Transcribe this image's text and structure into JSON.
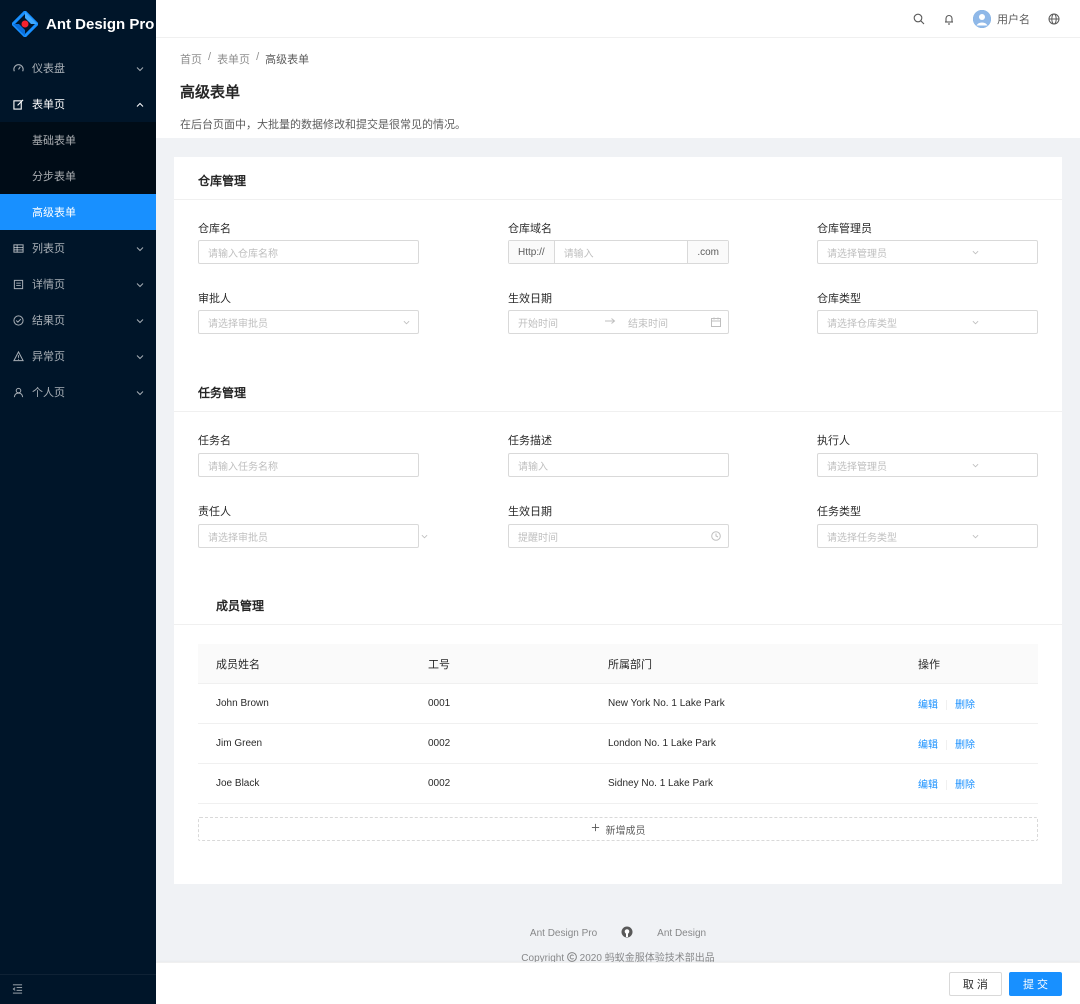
{
  "brand": {
    "title": "Ant Design Pro",
    "accent": "#1890ff"
  },
  "sidebar": {
    "items": [
      {
        "label": "仪表盘",
        "icon": "dashboard-icon"
      },
      {
        "label": "表单页",
        "icon": "form-icon",
        "open": true
      },
      {
        "label": "列表页",
        "icon": "table-icon"
      },
      {
        "label": "详情页",
        "icon": "profile-icon"
      },
      {
        "label": "结果页",
        "icon": "check-circle-icon"
      },
      {
        "label": "异常页",
        "icon": "warning-icon"
      },
      {
        "label": "个人页",
        "icon": "user-icon"
      }
    ],
    "sub_items": [
      {
        "label": "基础表单"
      },
      {
        "label": "分步表单"
      },
      {
        "label": "高级表单",
        "active": true
      }
    ]
  },
  "header": {
    "username": "用户名"
  },
  "page": {
    "breadcrumb": [
      "首页",
      "/",
      "表单页",
      "/",
      "高级表单"
    ],
    "title": "高级表单",
    "description": "在后台页面中，大批量的数据修改和提交是很常见的情况。"
  },
  "warehouse": {
    "title": "仓库管理",
    "name_label": "仓库名",
    "name_placeholder": "请输入仓库名称",
    "domain_label": "仓库域名",
    "domain_prefix": "Http://",
    "domain_placeholder": "请输入",
    "domain_suffix": ".com",
    "admin_label": "仓库管理员",
    "admin_placeholder": "请选择管理员",
    "approver_label": "审批人",
    "approver_placeholder": "请选择审批员",
    "date_label": "生效日期",
    "date_start": "开始时间",
    "date_end": "结束时间",
    "type_label": "仓库类型",
    "type_placeholder": "请选择仓库类型"
  },
  "task": {
    "title": "任务管理",
    "name_label": "任务名",
    "name_placeholder": "请输入任务名称",
    "desc_label": "任务描述",
    "desc_placeholder": "请输入",
    "executor_label": "执行人",
    "executor_placeholder": "请选择管理员",
    "owner_label": "责任人",
    "owner_placeholder": "请选择审批员",
    "date_label": "生效日期",
    "date_placeholder": "提醒时间",
    "type_label": "任务类型",
    "type_placeholder": "请选择任务类型"
  },
  "members": {
    "title": "成员管理",
    "columns": [
      "成员姓名",
      "工号",
      "所属部门",
      "操作"
    ],
    "rows": [
      {
        "name": "John Brown",
        "id": "0001",
        "dept": "New York No. 1 Lake Park",
        "edit": "编辑",
        "delete": "删除"
      },
      {
        "name": "Jim Green",
        "id": "0002",
        "dept": "London No. 1 Lake Park",
        "edit": "编辑",
        "delete": "删除"
      },
      {
        "name": "Joe Black",
        "id": "0002",
        "dept": "Sidney No. 1 Lake Park",
        "edit": "编辑",
        "delete": "删除"
      }
    ],
    "add_label": "新增成员"
  },
  "footer": {
    "link_pro": "Ant Design Pro",
    "link_ad": "Ant Design",
    "copyright": "Copyright",
    "copyright_rest": "2020 蚂蚁金服体验技术部出品",
    "cancel": "取 消",
    "submit": "提 交"
  }
}
